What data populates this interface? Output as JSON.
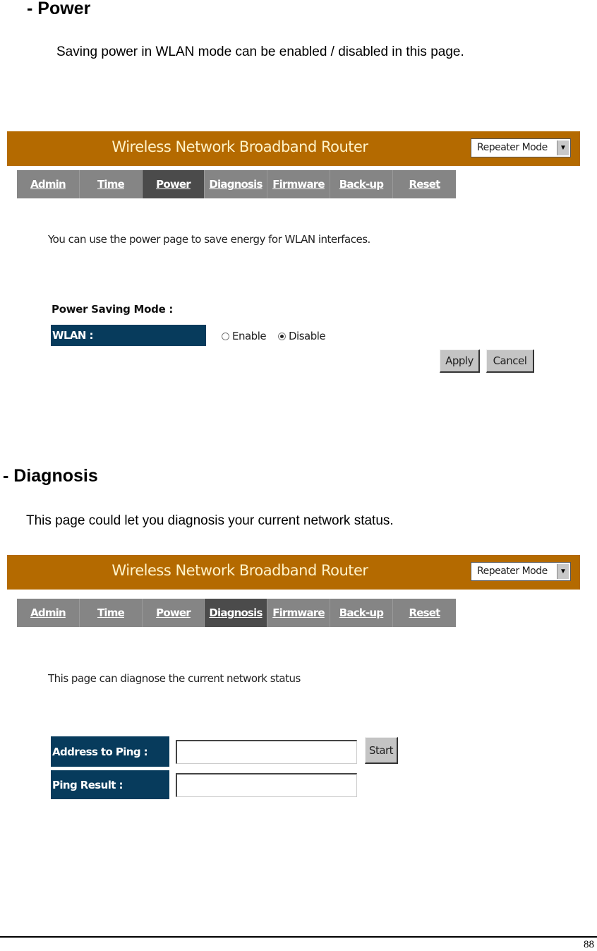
{
  "power_section": {
    "heading": "- Power",
    "description": "Saving power in WLAN mode can be enabled / disabled in this page.",
    "screenshot": {
      "banner_title": "Wireless Network Broadband Router",
      "mode_select": {
        "value": "Repeater Mode",
        "arrow_icon": "▼"
      },
      "tabs": [
        {
          "label": "Admin",
          "active": false
        },
        {
          "label": "Time",
          "active": false
        },
        {
          "label": "Power",
          "active": true
        },
        {
          "label": "Diagnosis",
          "active": false
        },
        {
          "label": "Firmware",
          "active": false
        },
        {
          "label": "Back-up",
          "active": false
        },
        {
          "label": "Reset",
          "active": false
        }
      ],
      "intro_text": "You can use the power page to save energy for WLAN interfaces.",
      "section_label": "Power Saving Mode :",
      "wlan_label": "WLAN :",
      "radio_options": [
        {
          "label": "Enable",
          "checked": false
        },
        {
          "label": "Disable",
          "checked": true
        }
      ],
      "apply_label": "Apply",
      "cancel_label": "Cancel"
    }
  },
  "diagnosis_section": {
    "heading": "- Diagnosis",
    "description": "This page could let you diagnosis your current network status.",
    "screenshot": {
      "banner_title": "Wireless Network Broadband Router",
      "mode_select": {
        "value": "Repeater Mode",
        "arrow_icon": "▼"
      },
      "tabs": [
        {
          "label": "Admin",
          "active": false
        },
        {
          "label": "Time",
          "active": false
        },
        {
          "label": "Power",
          "active": false
        },
        {
          "label": "Diagnosis",
          "active": true
        },
        {
          "label": "Firmware",
          "active": false
        },
        {
          "label": "Back-up",
          "active": false
        },
        {
          "label": "Reset",
          "active": false
        }
      ],
      "intro_text": "This page can diagnose the current network status",
      "address_label": "Address to Ping :",
      "address_value": "",
      "result_label": "Ping Result :",
      "result_value": "",
      "start_label": "Start"
    }
  },
  "colors": {
    "banner": "#b46a00",
    "banner_text": "#fff3c8",
    "nav": "#858585",
    "nav_active": "#4b4b4b",
    "label_bg": "#073b5c"
  },
  "page_number": "88"
}
